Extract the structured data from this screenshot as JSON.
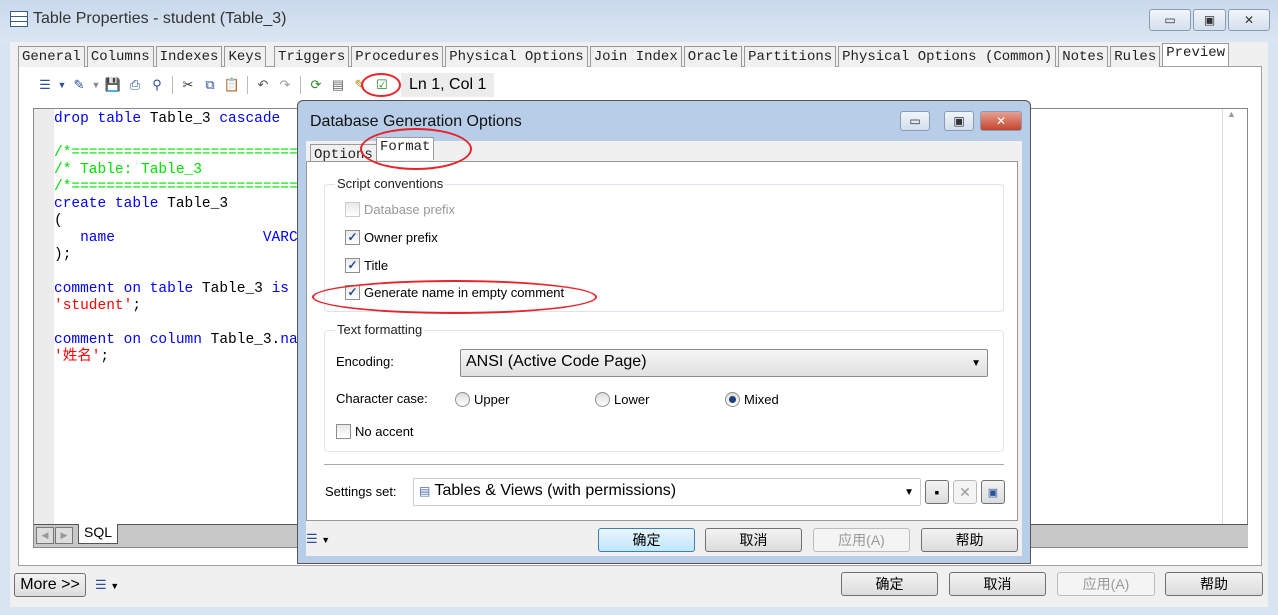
{
  "window": {
    "title": "Table Properties - student (Table_3)",
    "icon": "table-icon"
  },
  "tabs": [
    "General",
    "Columns",
    "Indexes",
    "Keys",
    "Triggers",
    "Procedures",
    "Physical Options",
    "Join Index",
    "Oracle",
    "Partitions",
    "Physical Options (Common)",
    "Notes",
    "Rules",
    "Preview"
  ],
  "active_tab": "Preview",
  "toolbar": {
    "status": "Ln 1, Col 1"
  },
  "editor": {
    "bottom_tab": "SQL"
  },
  "dialog": {
    "title": "Database Generation Options",
    "tabs": [
      "Options",
      "Format"
    ],
    "active_tab": "Format",
    "script_conventions": {
      "label": "Script conventions",
      "items": [
        {
          "label": "Database prefix",
          "checked": false,
          "disabled": true
        },
        {
          "label": "Owner prefix",
          "checked": true
        },
        {
          "label": "Title",
          "checked": true
        },
        {
          "label": "Generate name in empty comment",
          "checked": true
        }
      ]
    },
    "text_formatting": {
      "label": "Text formatting",
      "encoding_label": "Encoding:",
      "encoding_value": "ANSI (Active Code Page)",
      "case_label": "Character case:",
      "case_options": [
        "Upper",
        "Lower",
        "Mixed"
      ],
      "case_selected": "Mixed",
      "no_accent": {
        "label": "No accent",
        "checked": false
      }
    },
    "settings_label": "Settings set:",
    "settings_value": "Tables & Views (with permissions)",
    "buttons": {
      "ok": "确定",
      "cancel": "取消",
      "apply": "应用(A)",
      "help": "帮助"
    }
  },
  "footer": {
    "more": "More >>",
    "ok": "确定",
    "cancel": "取消",
    "apply": "应用(A)",
    "help": "帮助"
  },
  "colors": {
    "keyword": "#0000ff",
    "comment": "#00e000",
    "string": "#ff0000",
    "highlight": "#e8232a"
  }
}
